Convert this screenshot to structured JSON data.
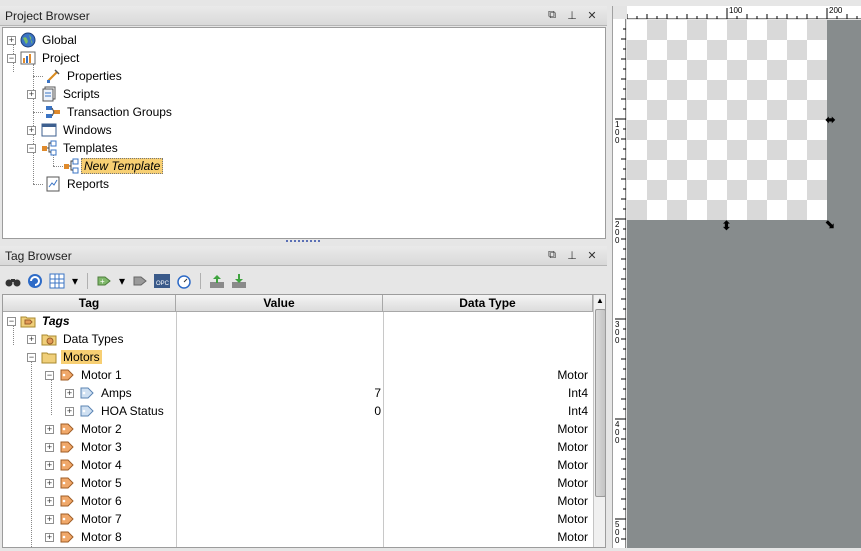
{
  "project_browser": {
    "title": "Project Browser",
    "items": [
      {
        "label": "Global"
      },
      {
        "label": "Project"
      },
      {
        "label": "Properties"
      },
      {
        "label": "Scripts"
      },
      {
        "label": "Transaction Groups"
      },
      {
        "label": "Windows"
      },
      {
        "label": "Templates"
      },
      {
        "label": "New Template"
      },
      {
        "label": "Reports"
      }
    ]
  },
  "tag_browser": {
    "title": "Tag Browser",
    "columns": {
      "tag": "Tag",
      "value": "Value",
      "data_type": "Data Type"
    },
    "rows": [
      {
        "tag": "Tags",
        "value": "",
        "data_type": ""
      },
      {
        "tag": "Data Types",
        "value": "",
        "data_type": ""
      },
      {
        "tag": "Motors",
        "value": "",
        "data_type": ""
      },
      {
        "tag": "Motor 1",
        "value": "",
        "data_type": "Motor"
      },
      {
        "tag": "Amps",
        "value": "7",
        "data_type": "Int4"
      },
      {
        "tag": "HOA Status",
        "value": "0",
        "data_type": "Int4"
      },
      {
        "tag": "Motor 2",
        "value": "",
        "data_type": "Motor"
      },
      {
        "tag": "Motor 3",
        "value": "",
        "data_type": "Motor"
      },
      {
        "tag": "Motor 4",
        "value": "",
        "data_type": "Motor"
      },
      {
        "tag": "Motor 5",
        "value": "",
        "data_type": "Motor"
      },
      {
        "tag": "Motor 6",
        "value": "",
        "data_type": "Motor"
      },
      {
        "tag": "Motor 7",
        "value": "",
        "data_type": "Motor"
      },
      {
        "tag": "Motor 8",
        "value": "",
        "data_type": "Motor"
      }
    ],
    "toolbar_icons": [
      "binoculars-icon",
      "refresh-icon",
      "grid-icon",
      "dropdown-icon",
      "add-tag-icon",
      "dropdown-icon",
      "delete-tag-icon",
      "opc-icon",
      "timer-icon",
      "export-icon",
      "import-icon"
    ]
  },
  "designer": {
    "ruler_h": [
      "100",
      "200"
    ],
    "ruler_v": [
      "100",
      "200",
      "300",
      "400",
      "500"
    ]
  },
  "colors": {
    "selection": "#f7cf73",
    "canvas_gray": "#878c8d",
    "checker": "#d9d9d9"
  }
}
